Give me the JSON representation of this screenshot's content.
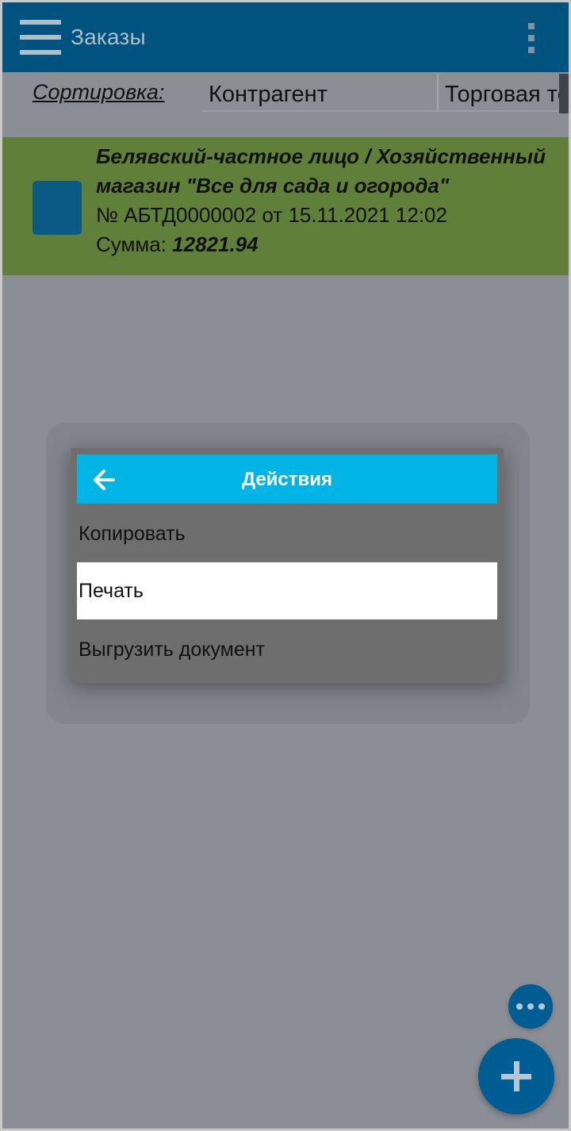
{
  "appbar": {
    "title": "Заказы",
    "menu_icon": "hamburger-icon",
    "overflow_icon": "kebab-menu-icon"
  },
  "sort": {
    "label": "Сортировка:",
    "columns": [
      "Контрагент",
      "Торговая то"
    ]
  },
  "order": {
    "name_line1": "Белявский-частное лицо / Хозяйственный",
    "name_line2": "магазин \"Все для сада и огорода\"",
    "number_line": "№ АБТД0000002 от 15.11.2021 12:02",
    "sum_label": "Сумма: ",
    "sum_value": "12821.94"
  },
  "dialog": {
    "title": "Действия",
    "back_icon": "arrow-left-icon",
    "items": [
      {
        "label": "Копировать"
      },
      {
        "label": "Печать"
      },
      {
        "label": "Выгрузить документ"
      }
    ]
  },
  "fab": {
    "more_icon": "more-horizontal-icon",
    "add_icon": "plus-icon"
  },
  "colors": {
    "appbar": "#00527f",
    "card": "#607f38",
    "dialog_header": "#00b4e6",
    "fab": "#005d94",
    "overlay": "#8b8e95"
  }
}
